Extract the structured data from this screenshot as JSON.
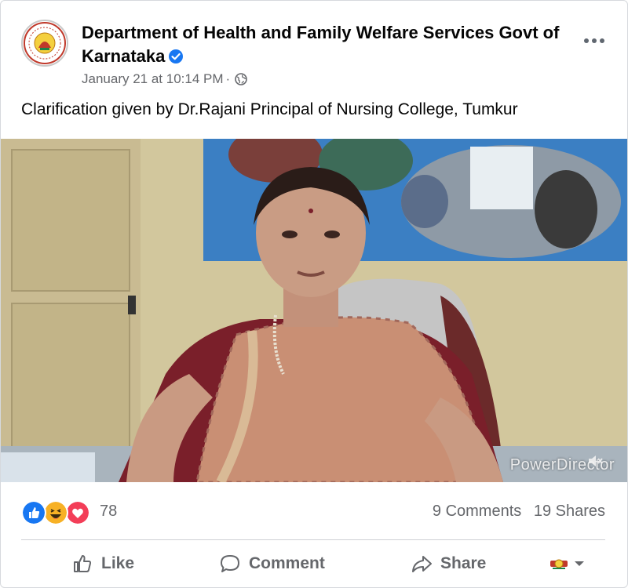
{
  "post": {
    "page_name": "Department of Health and Family Welfare Services Govt of Karnataka",
    "verified": true,
    "timestamp": "January 21 at 10:14 PM",
    "separator": "·",
    "audience_icon": "globe-icon",
    "caption": "Clarification given by Dr.Rajani Principal of Nursing College, Tumkur"
  },
  "video": {
    "watermark": "PowerDirector"
  },
  "reactions": {
    "types": [
      "like",
      "haha",
      "love"
    ],
    "count": "78",
    "comments": "9 Comments",
    "shares": "19 Shares"
  },
  "actions": {
    "like": "Like",
    "comment": "Comment",
    "share": "Share"
  },
  "colors": {
    "brand_blue": "#1877f2",
    "love_red": "#f33e58",
    "haha_yellow": "#f7b125",
    "muted_text": "#65676b"
  }
}
